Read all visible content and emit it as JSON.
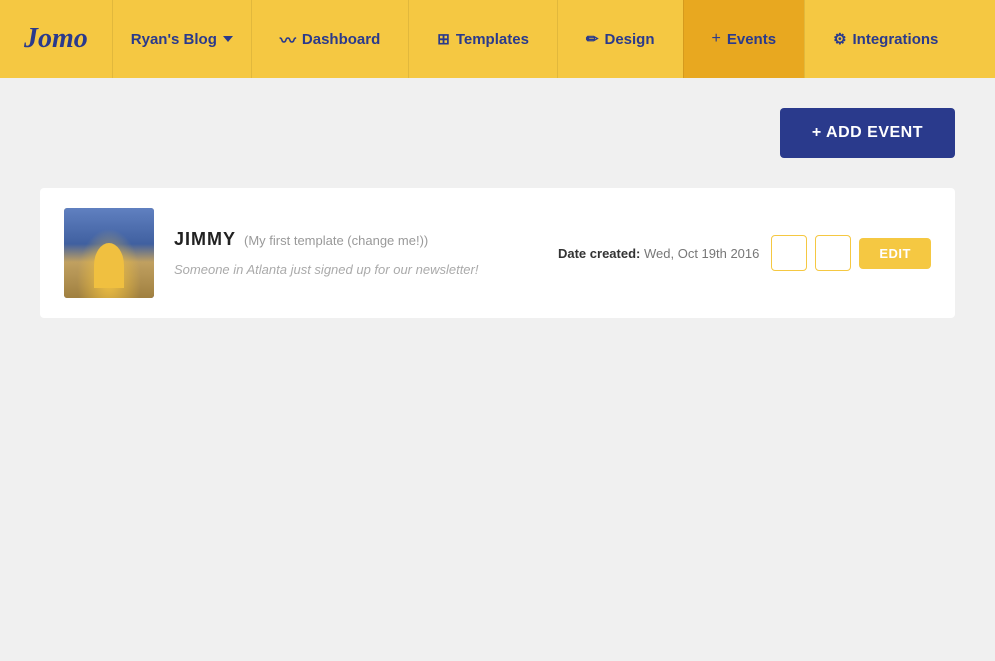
{
  "app": {
    "logo": "Jomo"
  },
  "nav": {
    "blog_label": "Ryan's Blog",
    "dashboard_label": "Dashboard",
    "templates_label": "Templates",
    "design_label": "Design",
    "events_label": "Events",
    "integrations_label": "Integrations",
    "active": "Events"
  },
  "main": {
    "add_event_button": "+ ADD EVENT",
    "template": {
      "name": "JIMMY",
      "subtitle": "(My first template (change me!))",
      "preview_text": "Someone in Atlanta just signed up for our newsletter!",
      "date_created_label": "Date created:",
      "date_created_value": "Wed, Oct 19th 2016",
      "edit_label": "EDIT"
    }
  }
}
